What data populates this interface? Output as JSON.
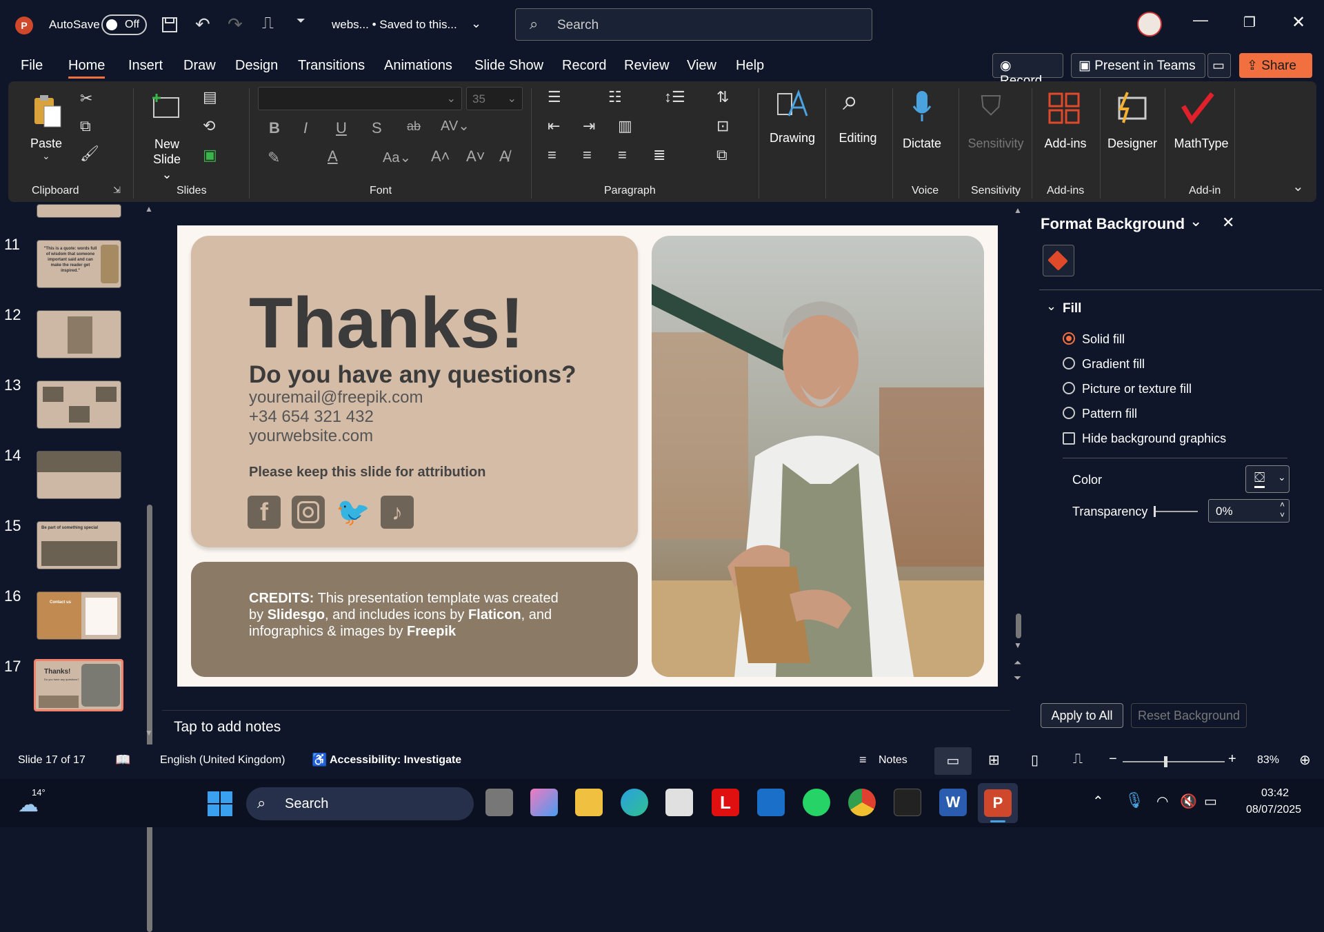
{
  "titlebar": {
    "autosave_label": "AutoSave",
    "autosave_state": "Off",
    "doc_title": "webs... • Saved to this...",
    "search_placeholder": "Search"
  },
  "menu": [
    "File",
    "Home",
    "Insert",
    "Draw",
    "Design",
    "Transitions",
    "Animations",
    "Slide Show",
    "Record",
    "Review",
    "View",
    "Help"
  ],
  "top_buttons": {
    "record": "Record",
    "present": "Present in Teams",
    "share": "Share"
  },
  "ribbon": {
    "paste": "Paste",
    "new_slide_1": "New",
    "new_slide_2": "Slide",
    "font_size": "35",
    "drawing": "Drawing",
    "editing": "Editing",
    "dictate": "Dictate",
    "sensitivity": "Sensitivity",
    "addins": "Add-ins",
    "designer": "Designer",
    "mathtype": "MathType",
    "groups": {
      "clipboard": "Clipboard",
      "slides": "Slides",
      "font": "Font",
      "paragraph": "Paragraph",
      "voice": "Voice",
      "sensitivity": "Sensitivity",
      "addins": "Add-ins",
      "addin": "Add-in"
    }
  },
  "thumbnails": [
    {
      "num": "11"
    },
    {
      "num": "12"
    },
    {
      "num": "13"
    },
    {
      "num": "14"
    },
    {
      "num": "15"
    },
    {
      "num": "16"
    },
    {
      "num": "17",
      "mini_title": "Thanks!",
      "mini_sub": "Do you have any questions?"
    }
  ],
  "slide": {
    "title": "Thanks!",
    "subtitle": "Do you have any questions?",
    "email": "youremail@freepik.com",
    "phone": "+34 654 321 432",
    "website": "yourwebsite.com",
    "attribution": "Please keep this slide for attribution",
    "credits_label": "CREDITS:",
    "credits_1": " This presentation template was created",
    "credits_2a": "by ",
    "credits_slidesgo": "Slidesgo",
    "credits_2b": ", and includes icons by ",
    "credits_flaticon": "Flaticon",
    "credits_2c": ", and",
    "credits_3a": "infographics & images by ",
    "credits_freepik": "Freepik",
    "thumb11": "\"This is a quote: words full of wisdom that someone important said and can make the reader get inspired.\"",
    "thumb16": "Contact us",
    "thumb15": "Be part of something special"
  },
  "notes_placeholder": "Tap to add notes",
  "pane": {
    "title": "Format Background",
    "fill_section": "Fill",
    "options": [
      "Solid fill",
      "Gradient fill",
      "Picture or texture fill",
      "Pattern fill"
    ],
    "hide_bg": "Hide background graphics",
    "color_label": "Color",
    "transparency_label": "Transparency",
    "transparency_value": "0%",
    "apply_all": "Apply to All",
    "reset": "Reset Background"
  },
  "status": {
    "slide": "Slide 17 of 17",
    "language": "English (United Kingdom)",
    "accessibility": "Accessibility: Investigate",
    "notes": "Notes",
    "zoom": "83%"
  },
  "taskbar": {
    "search": "Search",
    "temp": "14°",
    "time": "03:42",
    "date": "08/07/2025"
  },
  "colors": {
    "accent": "#f2703f",
    "card": "#d5bca6",
    "credits": "#8a7a66"
  }
}
